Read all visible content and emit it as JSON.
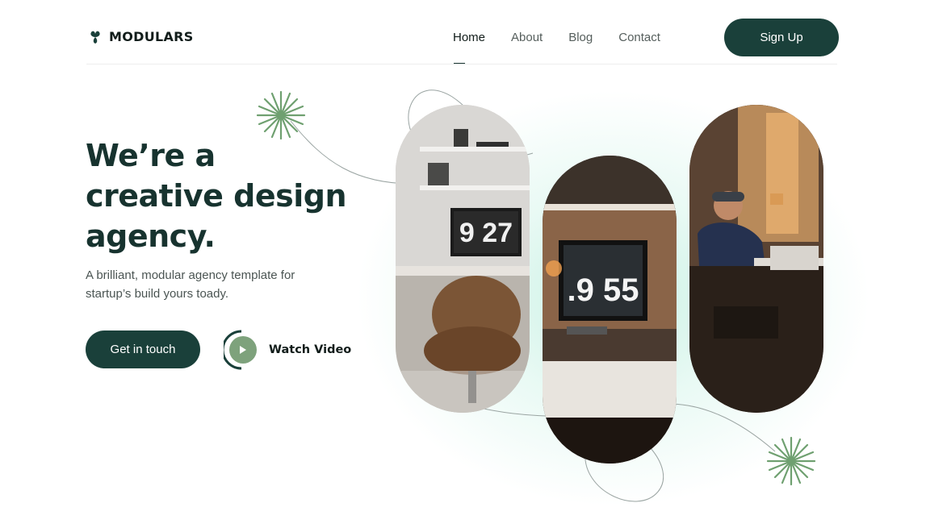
{
  "header": {
    "logo_text": "MODULARS",
    "nav": [
      {
        "label": "Home",
        "active": true
      },
      {
        "label": "About"
      },
      {
        "label": "Blog"
      },
      {
        "label": "Contact"
      }
    ],
    "signup_label": "Sign Up"
  },
  "hero": {
    "title": "We’re a creative design agency.",
    "subtitle": "A brilliant, modular agency template for startup’s build yours toady.",
    "cta_label": "Get in touch",
    "watch_label": "Watch Video"
  },
  "gallery": {
    "images": [
      {
        "clock_text": "9 27"
      },
      {
        "clock_text": ".9 55"
      },
      {
        "clock_text": ""
      }
    ]
  },
  "colors": {
    "primary": "#1a403a",
    "accent_green": "#6fa070",
    "glow": "#bfeede"
  },
  "icons": {
    "logo": "clover-leaf-icon",
    "play": "play-icon",
    "decoration": "starburst-icon"
  }
}
